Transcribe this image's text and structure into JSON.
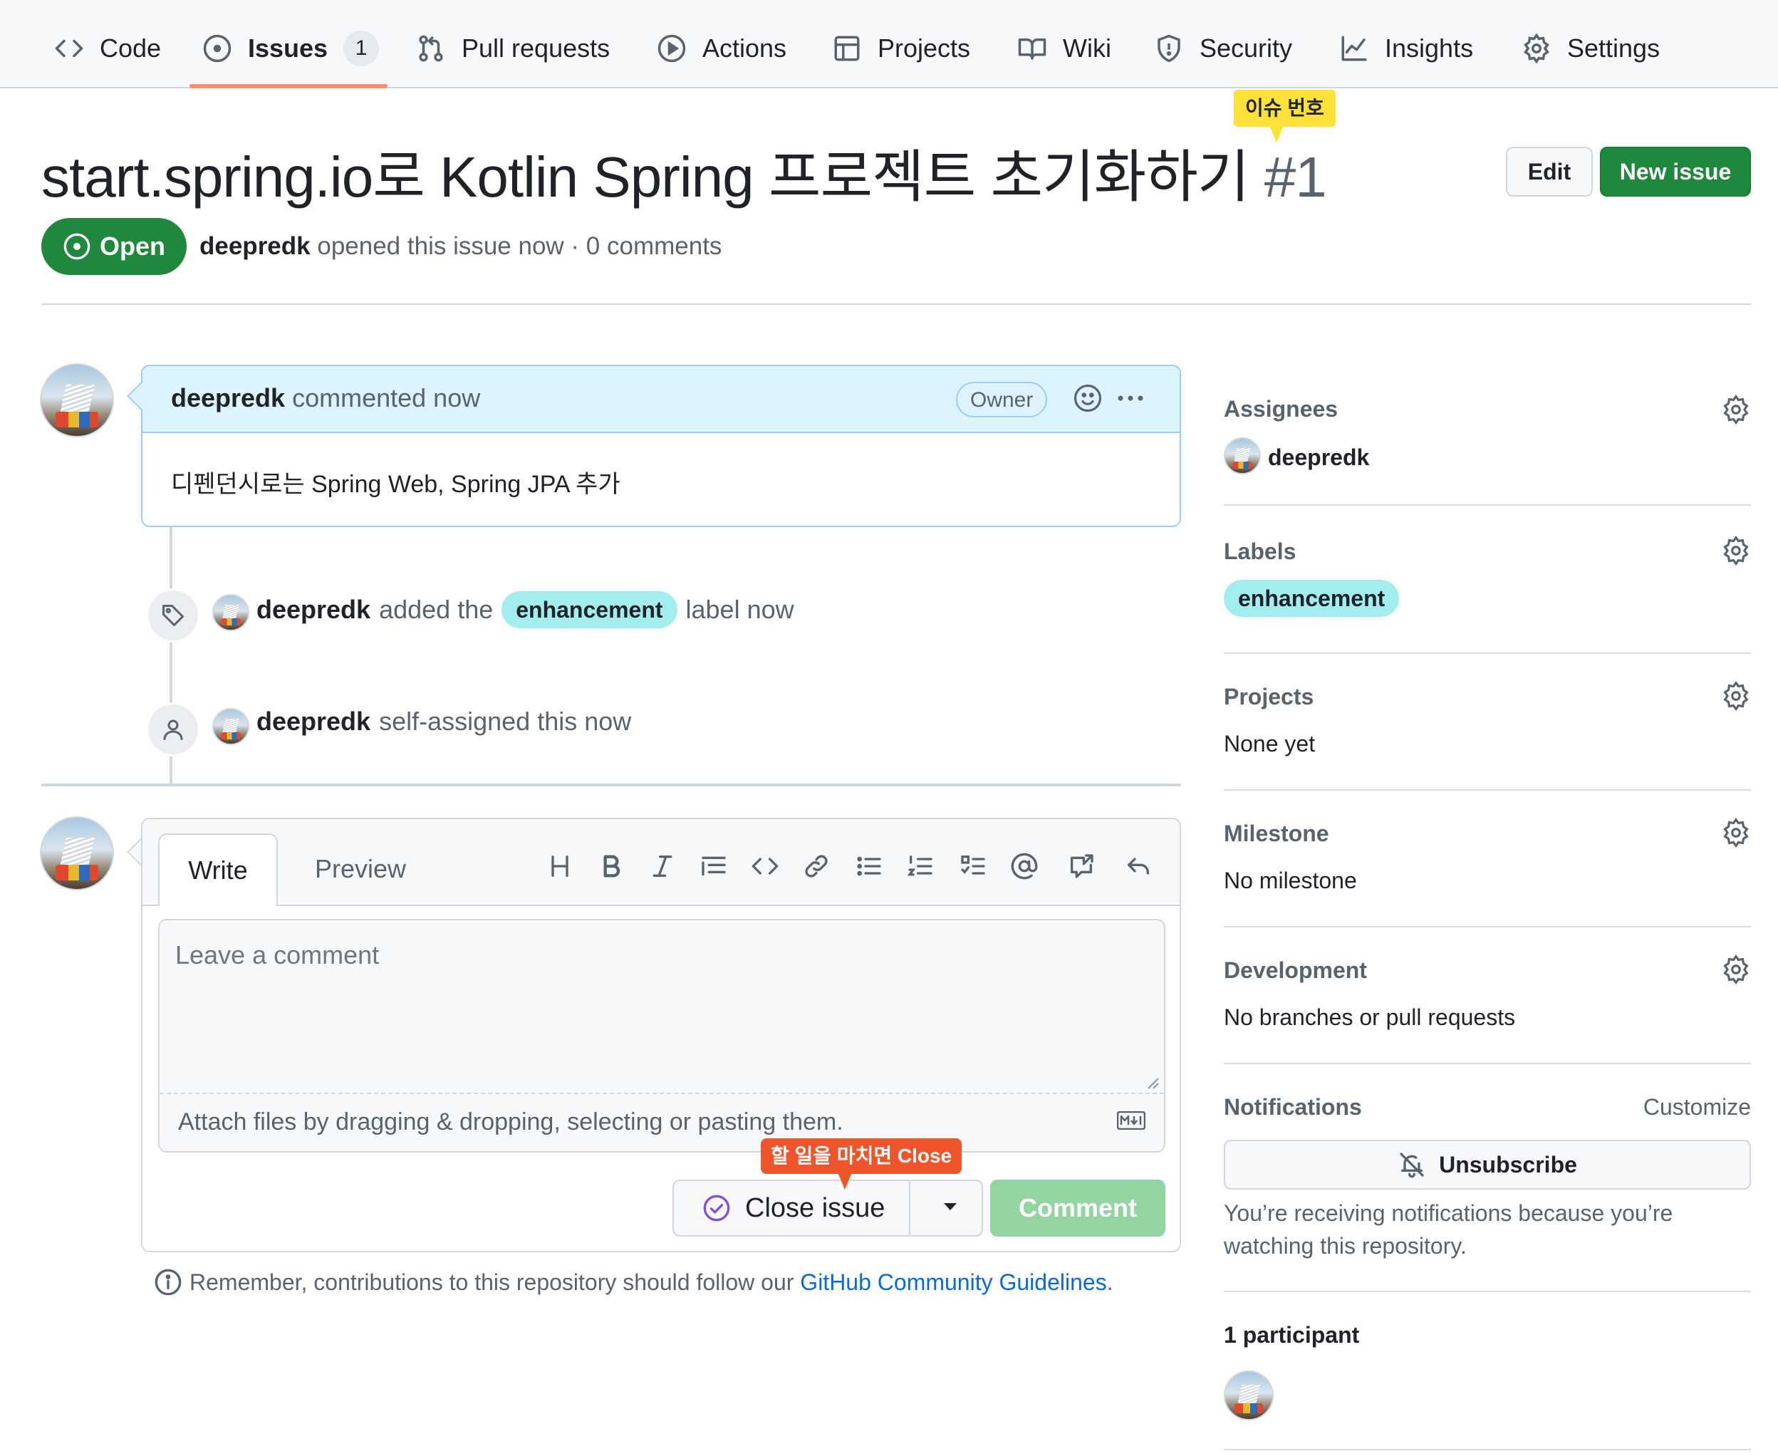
{
  "tabs": [
    {
      "label": "Code",
      "icon": "code-icon"
    },
    {
      "label": "Issues",
      "icon": "issue-opened-icon",
      "count": "1",
      "active": true
    },
    {
      "label": "Pull requests",
      "icon": "git-pull-request-icon"
    },
    {
      "label": "Actions",
      "icon": "play-icon"
    },
    {
      "label": "Projects",
      "icon": "table-icon"
    },
    {
      "label": "Wiki",
      "icon": "book-icon"
    },
    {
      "label": "Security",
      "icon": "shield-icon"
    },
    {
      "label": "Insights",
      "icon": "graph-icon"
    },
    {
      "label": "Settings",
      "icon": "gear-icon"
    }
  ],
  "issue": {
    "title": "start.spring.io로 Kotlin Spring 프로젝트 초기화하기",
    "number": "#1",
    "number_callout": "이슈 번호",
    "state": "Open",
    "author": "deepredk",
    "meta_rest": "opened this issue now · 0 comments",
    "edit_label": "Edit",
    "new_issue_label": "New issue"
  },
  "comment": {
    "author": "deepredk",
    "when": "commented now",
    "badge": "Owner",
    "body": "디펜던시로는 Spring Web, Spring JPA 추가"
  },
  "timeline": [
    {
      "actor": "deepredk",
      "pre": "added the",
      "label": "enhancement",
      "post": "label now",
      "icon": "tag-icon"
    },
    {
      "actor": "deepredk",
      "pre": "self-assigned this now",
      "icon": "person-icon"
    }
  ],
  "editor": {
    "write_tab": "Write",
    "preview_tab": "Preview",
    "placeholder": "Leave a comment",
    "attach_hint": "Attach files by dragging & dropping, selecting or pasting them.",
    "close_label": "Close issue",
    "close_callout": "할 일을 마치면 Close",
    "comment_label": "Comment",
    "guidelines_pre": "Remember, contributions to this repository should follow our",
    "guidelines_link": "GitHub Community Guidelines",
    "guidelines_post": "."
  },
  "sidebar": {
    "assignees": {
      "heading": "Assignees",
      "value": "deepredk"
    },
    "labels": {
      "heading": "Labels",
      "value": "enhancement"
    },
    "projects": {
      "heading": "Projects",
      "value": "None yet"
    },
    "milestone": {
      "heading": "Milestone",
      "value": "No milestone"
    },
    "development": {
      "heading": "Development",
      "value": "No branches or pull requests"
    },
    "notifications": {
      "heading": "Notifications",
      "customize": "Customize",
      "unsubscribe": "Unsubscribe",
      "note": "You’re receiving notifications because you’re watching this repository."
    },
    "participants": {
      "heading": "1 participant"
    }
  },
  "colors": {
    "accent_green": "#1f883d",
    "link_blue": "#0969da",
    "label_bg": "#a2eeef",
    "tab_underline": "#fd8c73",
    "callout_yellow": "#ffe13a",
    "callout_red": "#f0542b"
  }
}
